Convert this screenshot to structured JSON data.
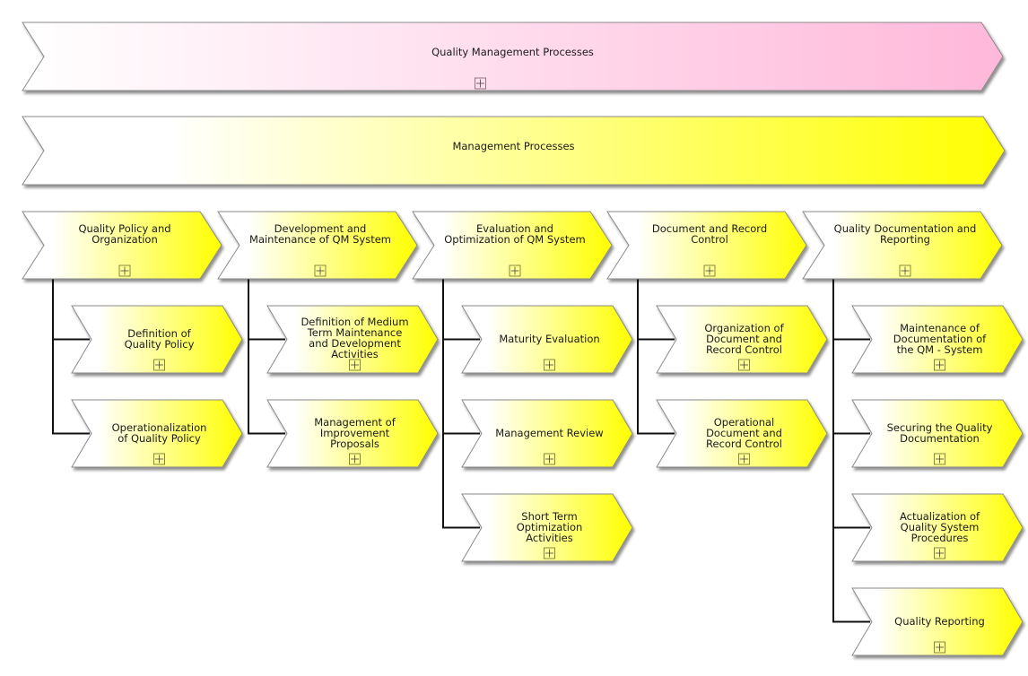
{
  "diagram_type": "value-added chain",
  "colors": {
    "pink_start": "#ffffff",
    "pink_end": "#ffb8da",
    "yellow_start": "#ffffff",
    "yellow_end": "#ffff00",
    "outline": "#8a8a8a",
    "connector": "#111111",
    "text": "#1a1a1a"
  },
  "banners": [
    {
      "id": "quality-management-processes",
      "label": "Quality Management Processes",
      "color": "pink",
      "expandable": true,
      "expand_icon": "plus-square-icon"
    },
    {
      "id": "management-processes",
      "label": "Management Processes",
      "color": "yellow",
      "expandable": false
    }
  ],
  "processes": [
    {
      "label_lines": [
        "Quality Policy and",
        "Organization"
      ],
      "expand_icon": "plus-square-icon",
      "children": [
        {
          "label_lines": [
            "Definition of",
            "Quality Policy"
          ]
        },
        {
          "label_lines": [
            "Operationalization",
            "of Quality Policy"
          ]
        }
      ]
    },
    {
      "label_lines": [
        "Development and",
        "Maintenance of QM System"
      ],
      "expand_icon": "plus-square-icon",
      "children": [
        {
          "label_lines": [
            "Definition of Medium",
            "Term Maintenance",
            "and Development",
            "Activities"
          ]
        },
        {
          "label_lines": [
            "Management of",
            "Improvement",
            "Proposals"
          ]
        }
      ]
    },
    {
      "label_lines": [
        "Evaluation and",
        "Optimization of QM System"
      ],
      "expand_icon": "plus-square-icon",
      "children": [
        {
          "label_lines": [
            "Maturity Evaluation"
          ]
        },
        {
          "label_lines": [
            "Management Review"
          ]
        },
        {
          "label_lines": [
            "Short Term",
            "Optimization",
            "Activities"
          ]
        }
      ]
    },
    {
      "label_lines": [
        "Document and Record",
        "Control"
      ],
      "expand_icon": "plus-square-icon",
      "children": [
        {
          "label_lines": [
            "Organization of",
            "Document and",
            "Record Control"
          ]
        },
        {
          "label_lines": [
            "Operational",
            "Document and",
            "Record Control"
          ]
        }
      ]
    },
    {
      "label_lines": [
        "Quality Documentation and",
        "Reporting"
      ],
      "expand_icon": "plus-square-icon",
      "children": [
        {
          "label_lines": [
            "Maintenance of",
            "Documentation of",
            "the QM - System"
          ]
        },
        {
          "label_lines": [
            "Securing the Quality",
            "Documentation"
          ]
        },
        {
          "label_lines": [
            "Actualization of",
            "Quality System",
            "Procedures"
          ]
        },
        {
          "label_lines": [
            "Quality Reporting"
          ]
        }
      ]
    }
  ]
}
